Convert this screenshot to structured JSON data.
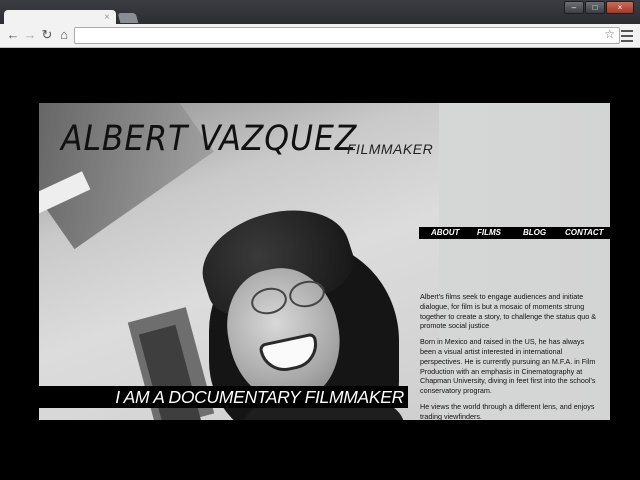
{
  "browser": {
    "tab_close_glyph": "×",
    "back_glyph": "←",
    "forward_glyph": "→",
    "reload_glyph": "↻",
    "home_glyph": "⌂",
    "star_glyph": "☆",
    "address_value": "",
    "window_minimize": "–",
    "window_maximize": "□",
    "window_close": "×"
  },
  "site": {
    "name": "ALBERT VAZQUEZ",
    "role": "FILMMAKER",
    "nav": [
      "ABOUT",
      "FILMS",
      "BLOG",
      "CONTACT"
    ],
    "bio": [
      "Albert's films seek to engage audiences and initiate dialogue, for film is but a mosaic of moments strung together to create a story, to challenge the status quo & promote social justice",
      "Born in Mexico and raised in the US, he has always been a visual artist interested in international perspectives. He is currently pursuing an M.F.A. in Film Production with an emphasis in Cinematography at Chapman University, diving in feet first into the school's conservatory program.",
      "He views the world through a different lens, and enjoys trading viewfinders."
    ],
    "banner": "I AM A DOCUMENTARY FILMMAKER"
  },
  "colors": {
    "page_background": "#000000",
    "site_background": "#d3d4d4",
    "nav_bar": "#000000",
    "nav_text": "#ffffff"
  }
}
